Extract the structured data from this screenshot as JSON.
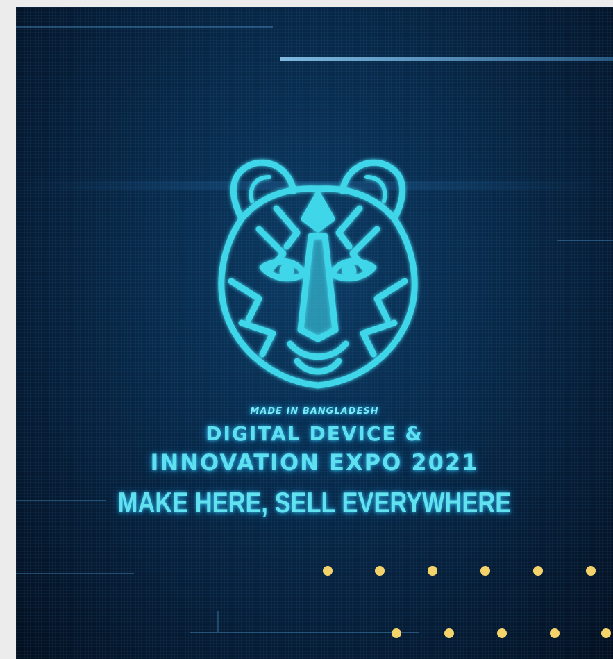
{
  "poster": {
    "eyebrow": "MADE IN BANGLADESH",
    "title_line1": "DIGITAL DEVICE &",
    "title_line2": "INNOVATION EXPO 2021",
    "tagline": "MAKE HERE, SELL EVERYWHERE",
    "logo_icon": "tiger-head-icon"
  },
  "colors": {
    "background": "#061c35",
    "glow": "#5fe0f0",
    "dots": "#f5d36b"
  }
}
